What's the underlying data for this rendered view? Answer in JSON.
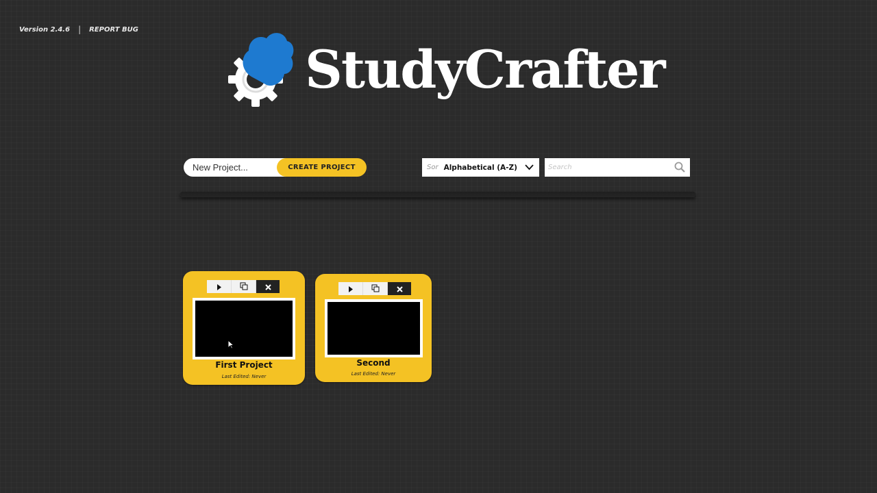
{
  "header": {
    "version": "Version 2.4.6",
    "separator": "|",
    "report_bug": "REPORT BUG"
  },
  "logo": {
    "wordmark": "StudyCrafter"
  },
  "create": {
    "input_placeholder": "New Project...",
    "button_label": "CREATE PROJECT"
  },
  "sort": {
    "prefix": "Sor",
    "value": "Alphabetical (A-Z)"
  },
  "search": {
    "placeholder": "Search"
  },
  "projects": [
    {
      "title": "First Project",
      "last_edited": "Last Edited: Never"
    },
    {
      "title": "Second",
      "last_edited": "Last Edited: Never"
    }
  ],
  "colors": {
    "background": "#2b2b2b",
    "accent": "#f4c224",
    "logo_blue": "#1e7ad0"
  },
  "icons": [
    "play-icon",
    "duplicate-icon",
    "close-icon",
    "chevron-down-icon",
    "search-icon",
    "gear-icon",
    "cloud-icon"
  ]
}
